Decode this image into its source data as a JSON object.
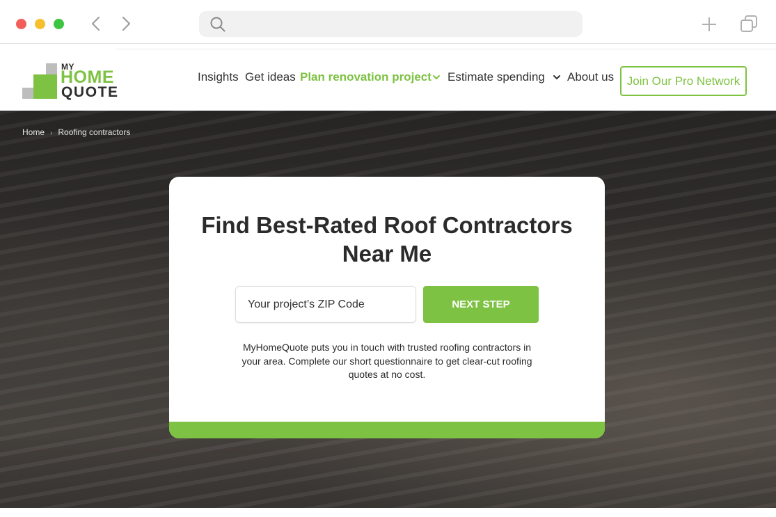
{
  "browser": {
    "icons": [
      "back-arrow-icon",
      "forward-arrow-icon",
      "search-icon",
      "plus-icon",
      "tabs-icon"
    ],
    "url": ""
  },
  "header": {
    "logo": {
      "my": "MY",
      "home": "HOME",
      "quote": "QUOTE"
    },
    "nav": {
      "insights": "Insights",
      "get_ideas": "Get ideas",
      "plan": "Plan renovation project",
      "estimate": "Estimate spending",
      "about": "About us"
    },
    "join_button": "Join Our Pro Network"
  },
  "breadcrumb": {
    "home": "Home",
    "current": "Roofing contractors"
  },
  "hero_card": {
    "title": "Find Best-Rated Roof Contractors Near Me",
    "zip_placeholder": "Your project’s ZIP Code",
    "next_button": "NEXT STEP",
    "description": "MyHomeQuote puts you in touch with trusted roofing contractors in your area. Complete our short questionnaire to get clear-cut roofing quotes at no cost."
  },
  "colors": {
    "brand_green": "#7dc242",
    "text_dark": "#2b2b2b"
  }
}
